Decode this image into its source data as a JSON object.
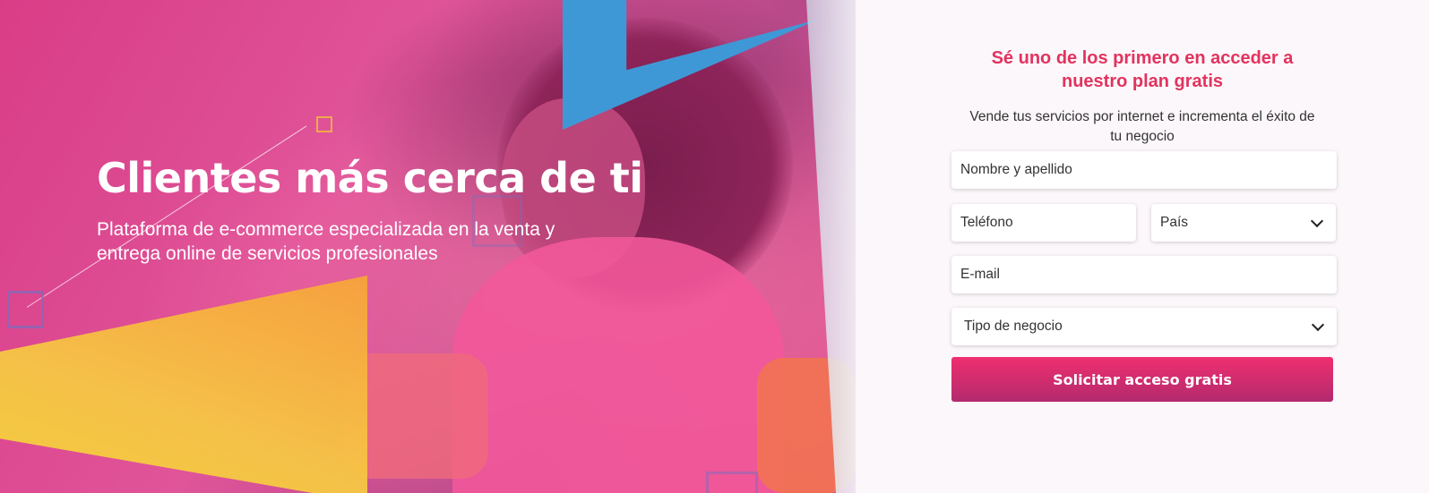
{
  "hero": {
    "title": "Clientes más cerca de ti",
    "subtitle": "Plataforma de e-commerce especializada en la venta y entrega online de servicios profesionales",
    "accent_colors": {
      "pink": "#e0549a",
      "yellow": "#f6c744",
      "blue": "#4aa6e0"
    }
  },
  "form": {
    "title": "Sé uno de los primero en acceder a nuestro plan gratis",
    "subtitle": "Vende tus servicios por internet e incrementa el éxito de tu negocio",
    "name_placeholder": "Nombre y apellido",
    "phone_placeholder": "Teléfono",
    "country_select": "País",
    "email_placeholder": "E-mail",
    "business_select": "Tipo de negocio",
    "submit_label": "Solicitar acceso gratis",
    "accent_color": "#e2335f"
  }
}
